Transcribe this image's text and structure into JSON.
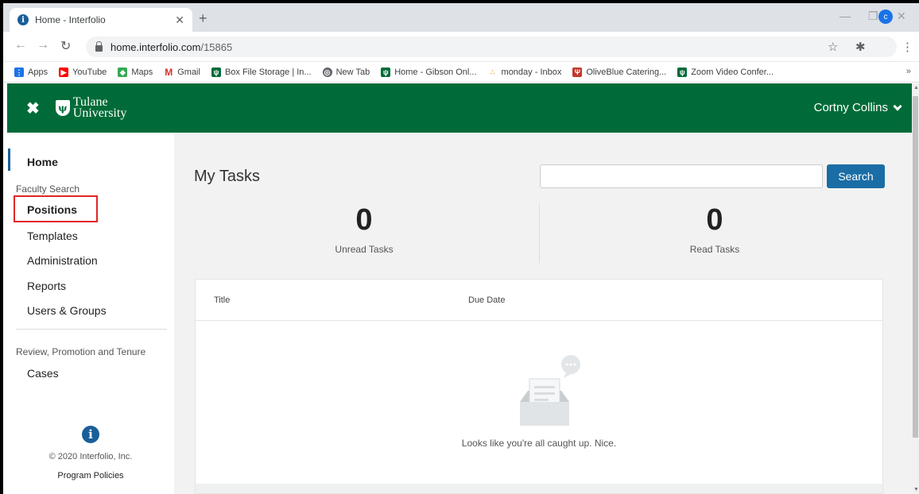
{
  "browser": {
    "tab_title": "Home - Interfolio",
    "url_host": "home.interfolio.com",
    "url_path": "/15865",
    "profile_initial": "c"
  },
  "bookmarks": [
    {
      "label": "Apps",
      "icon": "apps-grid-icon",
      "color": "#1a73e8"
    },
    {
      "label": "YouTube",
      "icon": "youtube-icon",
      "color": "#ff0000"
    },
    {
      "label": "Maps",
      "icon": "maps-icon",
      "color": "#34a853"
    },
    {
      "label": "Gmail",
      "icon": "gmail-icon",
      "color": "#d93025"
    },
    {
      "label": "Box File Storage | In...",
      "icon": "tulane-shield-icon",
      "color": "#006b38"
    },
    {
      "label": "New Tab",
      "icon": "globe-icon",
      "color": "#5f6368"
    },
    {
      "label": "Home - Gibson Onl...",
      "icon": "tulane-shield-icon",
      "color": "#006b38"
    },
    {
      "label": "monday - Inbox",
      "icon": "monday-icon",
      "color": "#f6a623"
    },
    {
      "label": "OliveBlue Catering...",
      "icon": "oliveblue-icon",
      "color": "#c0392b"
    },
    {
      "label": "Zoom Video Confer...",
      "icon": "tulane-shield-icon",
      "color": "#006b38"
    }
  ],
  "header": {
    "logo_line1": "Tulane",
    "logo_line2": "University",
    "user_name": "Cortny Collins",
    "brand_color": "#006b38"
  },
  "sidebar": {
    "home": "Home",
    "section1": "Faculty Search",
    "items1": [
      "Positions",
      "Templates",
      "Administration",
      "Reports",
      "Users & Groups"
    ],
    "section2": "Review, Promotion and Tenure",
    "items2": [
      "Cases"
    ],
    "copyright": "© 2020 Interfolio, Inc.",
    "policies": "Program Policies"
  },
  "main": {
    "title": "My Tasks",
    "search_button": "Search",
    "search_value": "",
    "unread_count": "0",
    "unread_label": "Unread Tasks",
    "read_count": "0",
    "read_label": "Read Tasks",
    "columns": [
      "Title",
      "Due Date"
    ],
    "empty_message": "Looks like you're all caught up. Nice."
  }
}
